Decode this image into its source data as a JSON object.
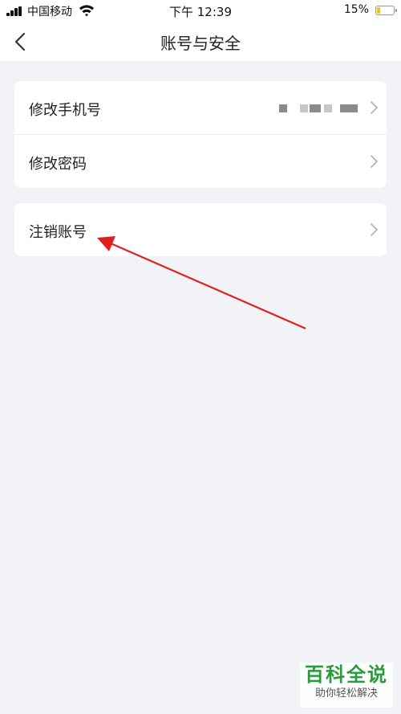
{
  "status_bar": {
    "carrier": "中国移动",
    "time": "下午 12:39",
    "battery_percent": "15%",
    "battery_level": 0.15
  },
  "nav": {
    "title": "账号与安全",
    "back_icon": "chevron-left-icon"
  },
  "settings": {
    "group1": [
      {
        "label": "修改手机号",
        "value_masked": true
      },
      {
        "label": "修改密码"
      }
    ],
    "group2": [
      {
        "label": "注销账号"
      }
    ]
  },
  "annotation": {
    "color": "#e02020"
  },
  "watermark": {
    "title": "百科全说",
    "subtitle": "助你轻松解决"
  }
}
